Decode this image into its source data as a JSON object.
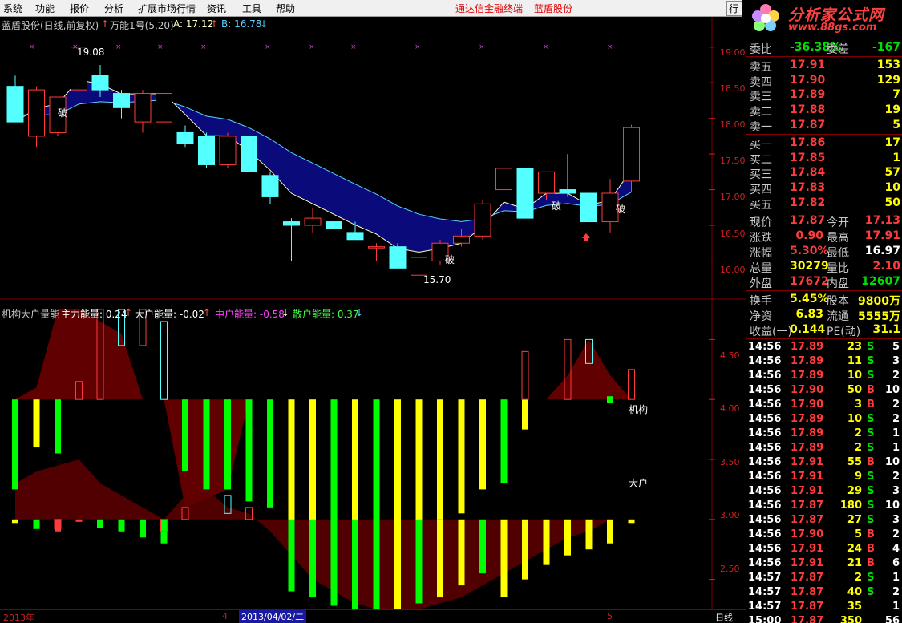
{
  "menu": [
    "系统",
    "功能",
    "报价",
    "分析",
    "扩展市场行情",
    "资讯",
    "工具",
    "帮助"
  ],
  "menu_center": [
    "通达信金融终端",
    "蓝盾股份"
  ],
  "hang_tab": "行",
  "logo": {
    "title": "分析家公式网",
    "url": "www.88gs.com"
  },
  "colors": {
    "up": "#ff3c3c",
    "down": "#54ffff",
    "fill": "#0a0a7a",
    "bg": "#000000",
    "grid": "#800000"
  },
  "price_header": {
    "stock": "蓝盾股份(日线,前复权)",
    "indicator": "万能1号(5,20)",
    "a_label": "A: 17.12",
    "b_label": "B: 16.78"
  },
  "indicator_header": {
    "name": "机构大户量能",
    "zl": "主力能量: 0.24",
    "dh": "大户能量: -0.02",
    "zh": "中户能量: -0.58",
    "sh": "散户能量: 0.37"
  },
  "price_axis": [
    "19.00",
    "18.50",
    "18.00",
    "17.50",
    "17.00",
    "16.50",
    "16.00"
  ],
  "ind_axis": [
    "4.50",
    "4.00",
    "3.50",
    "3.00",
    "2.50"
  ],
  "annotations": {
    "high": "19.08",
    "low": "15.70",
    "po": "破",
    "jigou": "机构",
    "dahu": "大户"
  },
  "bottom_axis": {
    "year": "2013年",
    "m4": "4",
    "date": "2013/04/02/二",
    "m5": "5",
    "period": "日线"
  },
  "quote_top": {
    "label": "委比",
    "value": "-36.38%",
    "label2": "委差",
    "value2": "-167"
  },
  "sells": [
    {
      "label": "卖五",
      "price": "17.91",
      "vol": "153"
    },
    {
      "label": "卖四",
      "price": "17.90",
      "vol": "129"
    },
    {
      "label": "卖三",
      "price": "17.89",
      "vol": "7"
    },
    {
      "label": "卖二",
      "price": "17.88",
      "vol": "19"
    },
    {
      "label": "卖一",
      "price": "17.87",
      "vol": "5"
    }
  ],
  "buys": [
    {
      "label": "买一",
      "price": "17.86",
      "vol": "17"
    },
    {
      "label": "买二",
      "price": "17.85",
      "vol": "1"
    },
    {
      "label": "买三",
      "price": "17.84",
      "vol": "57"
    },
    {
      "label": "买四",
      "price": "17.83",
      "vol": "10"
    },
    {
      "label": "买五",
      "price": "17.82",
      "vol": "50"
    }
  ],
  "stats": [
    {
      "l": "现价",
      "v": "17.87",
      "c": "red",
      "l2": "今开",
      "v2": "17.13",
      "c2": "red"
    },
    {
      "l": "涨跌",
      "v": "0.90",
      "c": "red",
      "l2": "最高",
      "v2": "17.91",
      "c2": "red"
    },
    {
      "l": "涨幅",
      "v": "5.30%",
      "c": "red",
      "l2": "最低",
      "v2": "16.97",
      "c2": "white"
    },
    {
      "l": "总量",
      "v": "30279",
      "c": "yellow",
      "l2": "量比",
      "v2": "2.10",
      "c2": "red"
    },
    {
      "l": "外盘",
      "v": "17672",
      "c": "red",
      "l2": "内盘",
      "v2": "12607",
      "c2": "green"
    }
  ],
  "stats2": [
    {
      "l": "换手",
      "v": "5.45%",
      "l2": "股本",
      "v2": "9800万"
    },
    {
      "l": "净资",
      "v": "6.83",
      "l2": "流通",
      "v2": "5555万"
    },
    {
      "l": "收益(一)",
      "v": "0.144",
      "l2": "PE(动)",
      "v2": "31.1"
    }
  ],
  "ticks": [
    {
      "t": "14:56",
      "p": "17.89",
      "v": "23",
      "s": "S",
      "c": "5"
    },
    {
      "t": "14:56",
      "p": "17.89",
      "v": "11",
      "s": "S",
      "c": "3"
    },
    {
      "t": "14:56",
      "p": "17.89",
      "v": "10",
      "s": "S",
      "c": "2"
    },
    {
      "t": "14:56",
      "p": "17.90",
      "v": "50",
      "s": "B",
      "c": "10"
    },
    {
      "t": "14:56",
      "p": "17.90",
      "v": "3",
      "s": "B",
      "c": "2"
    },
    {
      "t": "14:56",
      "p": "17.89",
      "v": "10",
      "s": "S",
      "c": "2"
    },
    {
      "t": "14:56",
      "p": "17.89",
      "v": "2",
      "s": "S",
      "c": "1"
    },
    {
      "t": "14:56",
      "p": "17.89",
      "v": "2",
      "s": "S",
      "c": "1"
    },
    {
      "t": "14:56",
      "p": "17.91",
      "v": "55",
      "s": "B",
      "c": "10"
    },
    {
      "t": "14:56",
      "p": "17.91",
      "v": "9",
      "s": "S",
      "c": "2"
    },
    {
      "t": "14:56",
      "p": "17.91",
      "v": "29",
      "s": "S",
      "c": "3"
    },
    {
      "t": "14:56",
      "p": "17.87",
      "v": "180",
      "s": "S",
      "c": "10"
    },
    {
      "t": "14:56",
      "p": "17.87",
      "v": "27",
      "s": "S",
      "c": "3"
    },
    {
      "t": "14:56",
      "p": "17.90",
      "v": "5",
      "s": "B",
      "c": "2"
    },
    {
      "t": "14:56",
      "p": "17.91",
      "v": "24",
      "s": "B",
      "c": "4"
    },
    {
      "t": "14:56",
      "p": "17.91",
      "v": "21",
      "s": "B",
      "c": "6"
    },
    {
      "t": "14:57",
      "p": "17.87",
      "v": "2",
      "s": "S",
      "c": "1"
    },
    {
      "t": "14:57",
      "p": "17.87",
      "v": "40",
      "s": "S",
      "c": "2"
    },
    {
      "t": "14:57",
      "p": "17.87",
      "v": "35",
      "s": "",
      "c": "1"
    },
    {
      "t": "15:00",
      "p": "17.87",
      "v": "350",
      "s": "",
      "c": "56"
    }
  ],
  "chart_data": [
    {
      "type": "candlestick",
      "title": "蓝盾股份(日线,前复权)",
      "ylim": [
        15.6,
        19.2
      ],
      "ohlc": [
        [
          18.45,
          18.6,
          17.95,
          17.95
        ],
        [
          17.75,
          18.45,
          17.6,
          18.4
        ],
        [
          17.8,
          18.3,
          17.75,
          18.3
        ],
        [
          18.4,
          19.08,
          18.3,
          19.0
        ],
        [
          18.6,
          18.75,
          18.3,
          18.4
        ],
        [
          18.35,
          18.4,
          18.0,
          18.15
        ],
        [
          17.95,
          18.4,
          17.8,
          18.35
        ],
        [
          17.95,
          18.45,
          17.9,
          18.35
        ],
        [
          17.8,
          17.9,
          17.6,
          17.65
        ],
        [
          17.75,
          17.8,
          17.3,
          17.35
        ],
        [
          17.35,
          17.8,
          17.3,
          17.75
        ],
        [
          17.75,
          17.75,
          17.15,
          17.25
        ],
        [
          17.2,
          17.25,
          16.8,
          16.9
        ],
        [
          16.55,
          16.6,
          16.0,
          16.5
        ],
        [
          16.5,
          16.75,
          16.4,
          16.6
        ],
        [
          16.55,
          16.55,
          16.4,
          16.45
        ],
        [
          16.4,
          16.55,
          16.35,
          16.3
        ],
        [
          16.2,
          16.25,
          16.0,
          16.2
        ],
        [
          16.2,
          16.25,
          15.9,
          15.9
        ],
        [
          15.8,
          16.05,
          15.7,
          16.05
        ],
        [
          16.0,
          16.3,
          15.95,
          16.25
        ],
        [
          16.25,
          16.45,
          16.2,
          16.35
        ],
        [
          16.35,
          16.85,
          16.3,
          16.8
        ],
        [
          17.0,
          17.35,
          16.95,
          17.3
        ],
        [
          17.3,
          17.3,
          16.6,
          16.6
        ],
        [
          16.95,
          17.25,
          16.85,
          17.25
        ],
        [
          17.0,
          17.5,
          16.9,
          16.95
        ],
        [
          16.95,
          17.05,
          16.5,
          16.55
        ],
        [
          16.55,
          17.15,
          16.4,
          16.95
        ],
        [
          17.12,
          17.91,
          16.97,
          17.87
        ]
      ]
    },
    {
      "type": "bar",
      "title": "机构大户量能",
      "ylim": [
        2.25,
        4.75
      ],
      "series": [
        {
          "name": "主力能量",
          "values": [
            0.24
          ]
        },
        {
          "name": "大户能量",
          "values": [
            -0.02
          ]
        },
        {
          "name": "中户能量",
          "values": [
            -0.58
          ]
        },
        {
          "name": "散户能量",
          "values": [
            0.37
          ]
        }
      ]
    }
  ]
}
